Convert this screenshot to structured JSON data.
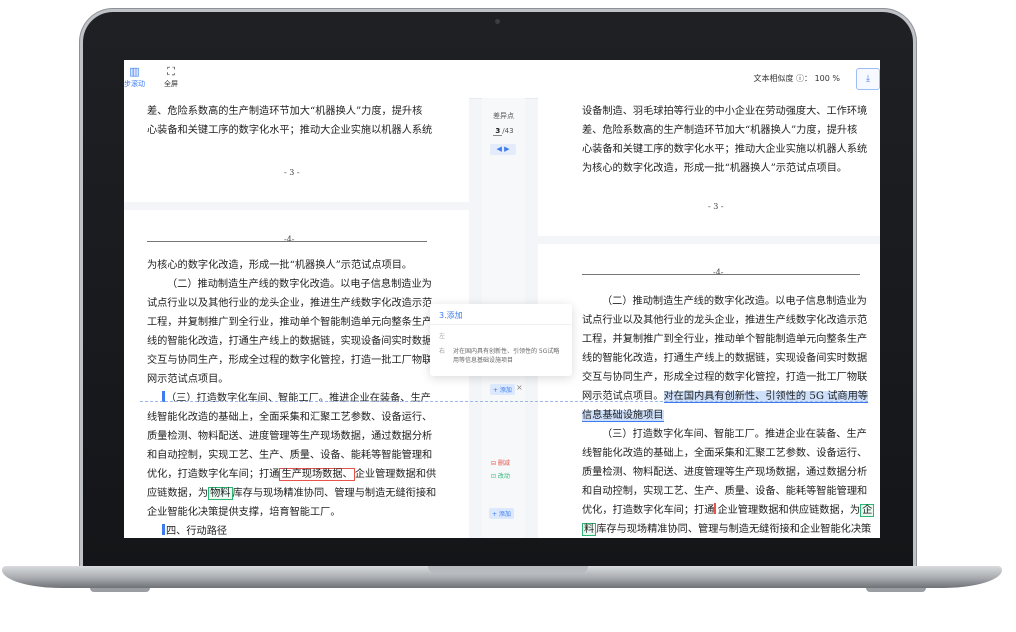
{
  "toolbar": {
    "sync_label": "步滚动",
    "sync_icon": "sync-scroll-icon",
    "fullscreen_label": "全屏",
    "fullscreen_icon": "fullscreen-icon",
    "similarity_label": "文本相似度 ⓘ：",
    "similarity_value": "100 %",
    "download_icon": "⤓"
  },
  "diff_panel": {
    "title": "差异点",
    "current": "3",
    "total": "/43",
    "nav_label": "◀ ▶",
    "add_tag_1": "+ 添加",
    "delete_tag": "⊟ 删减",
    "modify_tag": "⊡ 改动",
    "add_tag_2": "+ 添加"
  },
  "popup": {
    "title": "3.添加",
    "label_a": "左",
    "label_b": "右",
    "text": "对在国内具有创新性、引领性的 5G试略用等信息基础设施项目",
    "chip": "+ 添加",
    "close": "×"
  },
  "left_doc": {
    "lines_top": [
      "差、危险系数高的生产制造环节加大“机器换人”力度，提升核",
      "心装备和关键工序的数字化水平；推动大企业实施以机器人系统"
    ],
    "page_num": "- 3 -",
    "header_num": "-4-",
    "lines": [
      "为核心的数字化改造，形成一批“机器换人”示范试点项目。",
      "（二）推动制造生产线的数字化改造。以电子信息制造业为",
      "试点行业以及其他行业的龙头企业，推进生产线数字化改造示范",
      "工程，并复制推广到全行业，推动单个智能制造单元向整条生产",
      "线的智能化改造，打通生产线上的数据链，实现设备间实时数据",
      "交互与协同生产，形成全过程的数字化管控，打造一批工厂物联",
      "网示范试点项目。",
      "（三）打造数字化车间、智能工厂。推进企业在装备、生产",
      "线智能化改造的基础上，全面采集和汇聚工艺参数、设备运行、",
      "质量检测、物料配送、进度管理等生产现场数据，通过数据分析",
      "和自动控制，实现工艺、生产、质量、设备、能耗等智能管理和"
    ],
    "line_opt_a": "优化，打造数字化车间；打通",
    "line_opt_hl": "生产现场数据、",
    "line_opt_b": "企业管理数据和供",
    "line_supply_a": "应链数据，为",
    "line_supply_hl": "物料",
    "line_supply_b": "库存与现场精准协同、管理与制造无缝衔接和",
    "line_last1": "企业智能化决策提供支撑，培育智能工厂。",
    "line_last2": "四、行动路径"
  },
  "right_doc": {
    "lines_top": [
      "设备制造、羽毛球拍等行业的中小企业在劳动强度大、工作环境",
      "差、危险系数高的生产制造环节加大“机器换人”力度，提升核",
      "心装备和关键工序的数字化水平；推动大企业实施以机器人系统",
      "为核心的数字化改造，形成一批“机器换人”示范试点项目。"
    ],
    "page_num": "- 3 -",
    "header_num": "-4-",
    "lines": [
      "（二）推动制造生产线的数字化改造。以电子信息制造业为",
      "试点行业以及其他行业的龙头企业，推进生产线数字化改造示范",
      "工程，并复制推广到全行业，推动单个智能制造单元向整条生产",
      "线的智能化改造，打通生产线上的数据链，实现设备间实时数据",
      "交互与协同生产，形成全过程的数字化管控，打造一批工厂物联"
    ],
    "line_hl_a": "网示范试点项目。",
    "line_hl_b": "对在国内具有创新性、引领性的 5G 试商用等",
    "line_hl_c": "信息基础设施项目",
    "lines_after": [
      "（三）打造数字化车间、智能工厂。推进企业在装备、生产",
      "线智能化改造的基础上，全面采集和汇聚工艺参数、设备运行、",
      "质量检测、物料配送、进度管理等生产现场数据，通过数据分析",
      "和自动控制，实现工艺、生产、质量、设备、能耗等智能管理和"
    ],
    "line_opt_a": "优化，打造数字化车间；打通",
    "line_opt_b": "企业管理数据和供应链数据，为",
    "line_opt_hl": "企",
    "line_last_hl": "料",
    "line_last": "库存与现场精准协同、管理与制造无缝衔接和企业智能化决策"
  }
}
